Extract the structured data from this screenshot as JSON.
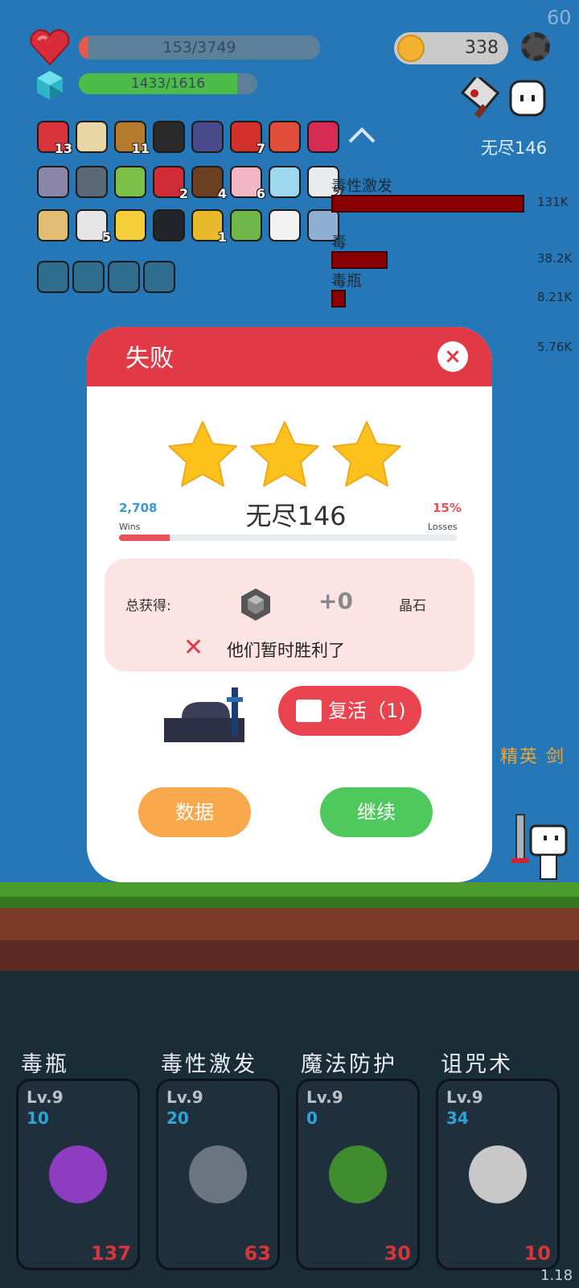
{
  "hud": {
    "fps": "60",
    "hp_text": "153/3749",
    "hp_fraction": 0.04,
    "mana_text": "1433/1616",
    "mana_fraction": 0.887,
    "coins": "338",
    "stage_label": "无尽146"
  },
  "inventory": {
    "row1": [
      {
        "icon": "watermelon-icon",
        "count": "13"
      },
      {
        "icon": "treasure-map-icon",
        "count": ""
      },
      {
        "icon": "book-icon",
        "count": "11"
      },
      {
        "icon": "cauldron-icon",
        "count": ""
      },
      {
        "icon": "wizard-hat-icon",
        "count": ""
      },
      {
        "icon": "apple-icon",
        "count": "7"
      },
      {
        "icon": "mushroom-icon",
        "count": ""
      },
      {
        "icon": "ruby-icon",
        "count": ""
      }
    ],
    "row2": [
      {
        "icon": "unicorn-icon",
        "count": ""
      },
      {
        "icon": "mortar-icon",
        "count": ""
      },
      {
        "icon": "lime-icon",
        "count": ""
      },
      {
        "icon": "strawberry-icon",
        "count": "2"
      },
      {
        "icon": "coconut-icon",
        "count": "4"
      },
      {
        "icon": "ice-cream-icon",
        "count": "6"
      },
      {
        "icon": "potion-flask-icon",
        "count": ""
      },
      {
        "icon": "ghost-icon",
        "count": "2"
      }
    ],
    "row3": [
      {
        "icon": "scroll-icon",
        "count": ""
      },
      {
        "icon": "envelope-icon",
        "count": "5"
      },
      {
        "icon": "cheese-icon",
        "count": ""
      },
      {
        "icon": "hood-icon",
        "count": ""
      },
      {
        "icon": "golden-egg-icon",
        "count": "1"
      },
      {
        "icon": "green-card-icon",
        "count": ""
      },
      {
        "icon": "playing-cards-icon",
        "count": ""
      },
      {
        "icon": "robe-icon",
        "count": ""
      }
    ],
    "row4": [
      "portal-icon",
      "portal-icon",
      "portal-icon",
      "portal-icon"
    ]
  },
  "damage": [
    {
      "label": "毒性激发",
      "value": "131K",
      "fraction": 1.0
    },
    {
      "label": "毒",
      "value": "38.2K",
      "fraction": 0.29
    },
    {
      "label": "毒瓶",
      "value": "8.21K",
      "fraction": 0.06
    },
    {
      "label": "",
      "value": "5.76K",
      "fraction": 0.04
    }
  ],
  "enemy": {
    "name": "精英 剑"
  },
  "modal": {
    "title": "失败",
    "close": "×",
    "stars": 3,
    "wins_value": "2,708",
    "wins_label": "Wins",
    "losses_value": "15%",
    "losses_label": "Losses",
    "loss_fraction": 0.15,
    "stage": "无尽146",
    "reward_label": "总获得:",
    "reward_amount": "+0",
    "reward_unit": "晶石",
    "result_message": "他们暂时胜利了",
    "revive_label": "复活（1)",
    "stats_button": "数据",
    "continue_button": "继续"
  },
  "skills": [
    {
      "name": "毒瓶",
      "level": "Lv.9",
      "value": "10",
      "cost": "137",
      "icon": "poison-bottle-icon"
    },
    {
      "name": "毒性激发",
      "level": "Lv.9",
      "value": "20",
      "cost": "63",
      "icon": "horned-skull-icon"
    },
    {
      "name": "魔法防护",
      "level": "Lv.9",
      "value": "0",
      "cost": "30",
      "icon": "leaf-icon"
    },
    {
      "name": "诅咒术",
      "level": "Lv.9",
      "value": "34",
      "cost": "10",
      "icon": "skull-icon"
    }
  ],
  "version": "1.18",
  "colors": {
    "accent_red": "#e13a46",
    "orange": "#f9a94b",
    "green": "#4fc95c",
    "hp": "#e05a4f",
    "mana": "#4cbb4a"
  }
}
